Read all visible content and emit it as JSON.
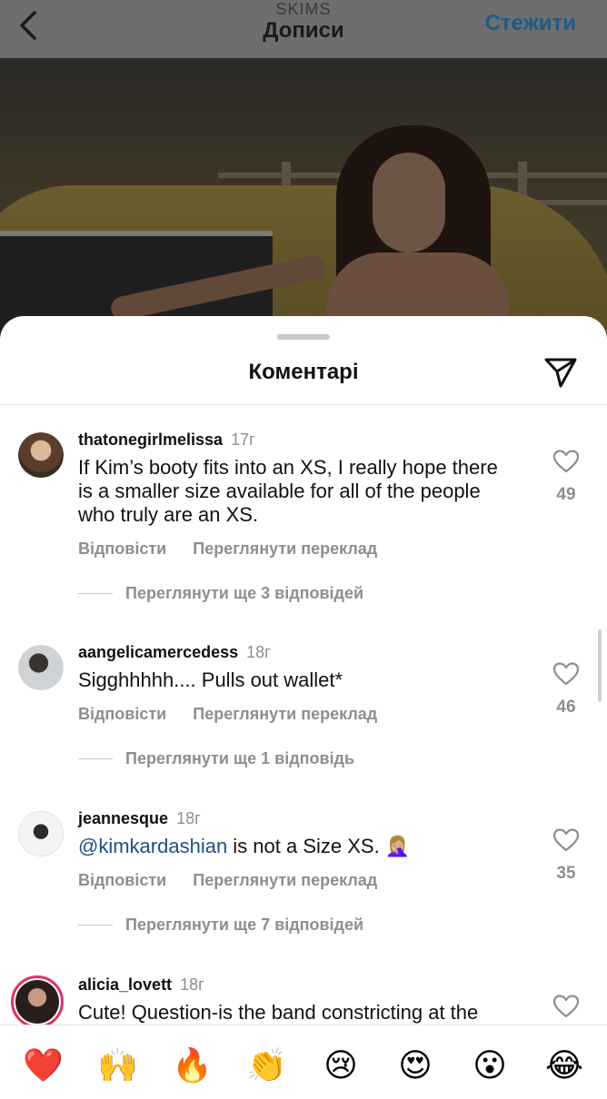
{
  "header": {
    "account": "SKIMS",
    "title": "Дописи",
    "follow_label": "Стежити"
  },
  "sheet": {
    "title": "Коментарі"
  },
  "comments": [
    {
      "username": "thatonegirlmelissa",
      "time": "17г",
      "text_lines": [
        "If Kim’s booty fits into an XS, I really hope there",
        "is a smaller size available for all of the people",
        "who truly are an XS."
      ],
      "likes": "49",
      "reply_label": "Відповісти",
      "translate_label": "Переглянути переклад",
      "more_replies": "Переглянути ще 3 відповідей"
    },
    {
      "username": "aangelicamercedess",
      "time": "18г",
      "text_lines": [
        "Sigghhhhh.... Pulls out wallet*"
      ],
      "likes": "46",
      "reply_label": "Відповісти",
      "translate_label": "Переглянути переклад",
      "more_replies": "Переглянути ще 1 відповідь"
    },
    {
      "username": "jeannesque",
      "time": "18г",
      "mention": "@kimkardashian",
      "text_rest": " is not a Size XS. 🤦🏼‍♀️",
      "likes": "35",
      "reply_label": "Відповісти",
      "translate_label": "Переглянути переклад",
      "more_replies": "Переглянути ще 7 відповідей"
    },
    {
      "username": "alicia_lovett",
      "time": "18г",
      "text_lines": [
        "Cute! Question-is the band constricting at the"
      ]
    }
  ],
  "emoji_bar": [
    "❤️",
    "🙌",
    "🔥",
    "👏",
    "😢",
    "😍",
    "😮",
    "😂"
  ],
  "colors": {
    "mention": "#1e4f82",
    "follow": "#1e5a86",
    "story_ring": "#e1306c"
  }
}
